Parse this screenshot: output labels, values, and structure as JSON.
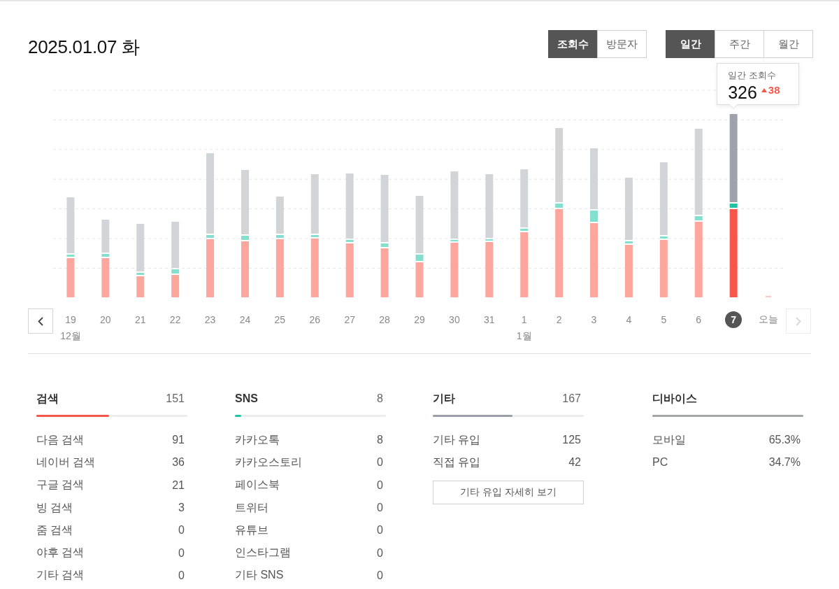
{
  "date_title": "2025.01.07 화",
  "metric_tabs": [
    {
      "label": "조회수",
      "selected": true
    },
    {
      "label": "방문자",
      "selected": false
    }
  ],
  "period_tabs": [
    {
      "label": "일간",
      "selected": true
    },
    {
      "label": "주간",
      "selected": false
    },
    {
      "label": "월간",
      "selected": false
    }
  ],
  "tooltip": {
    "title": "일간 조회수",
    "value": "326",
    "change": "38",
    "increase": true
  },
  "nav": {
    "prev_disabled": false,
    "next_disabled": true
  },
  "days": [
    {
      "day": "19",
      "month": "12월",
      "selected": false
    },
    {
      "day": "20",
      "selected": false
    },
    {
      "day": "21",
      "selected": false
    },
    {
      "day": "22",
      "selected": false
    },
    {
      "day": "23",
      "selected": false
    },
    {
      "day": "24",
      "selected": false
    },
    {
      "day": "25",
      "selected": false
    },
    {
      "day": "26",
      "selected": false
    },
    {
      "day": "27",
      "selected": false
    },
    {
      "day": "28",
      "selected": false
    },
    {
      "day": "29",
      "selected": false
    },
    {
      "day": "30",
      "selected": false
    },
    {
      "day": "31",
      "selected": false
    },
    {
      "day": "1",
      "month": "1월",
      "selected": false
    },
    {
      "day": "2",
      "selected": false
    },
    {
      "day": "3",
      "selected": false
    },
    {
      "day": "4",
      "selected": false
    },
    {
      "day": "5",
      "selected": false
    },
    {
      "day": "6",
      "selected": false
    },
    {
      "day": "7",
      "selected": true
    },
    {
      "day": "오늘",
      "selected": false
    }
  ],
  "sections": [
    {
      "title": "검색",
      "total": "151",
      "level": 0.48,
      "color": "#f2584a",
      "rows": [
        {
          "label": "다음 검색",
          "value": "91"
        },
        {
          "label": "네이버 검색",
          "value": "36"
        },
        {
          "label": "구글 검색",
          "value": "21"
        },
        {
          "label": "빙 검색",
          "value": "3"
        },
        {
          "label": "줌 검색",
          "value": "0"
        },
        {
          "label": "야후 검색",
          "value": "0"
        },
        {
          "label": "기타 검색",
          "value": "0"
        }
      ]
    },
    {
      "title": "SNS",
      "total": "8",
      "level": 0.04,
      "color": "#1fc3a4",
      "rows": [
        {
          "label": "카카오톡",
          "value": "8"
        },
        {
          "label": "카카오스토리",
          "value": "0"
        },
        {
          "label": "페이스북",
          "value": "0"
        },
        {
          "label": "트위터",
          "value": "0"
        },
        {
          "label": "유튜브",
          "value": "0"
        },
        {
          "label": "인스타그램",
          "value": "0"
        },
        {
          "label": "기타 SNS",
          "value": "0"
        }
      ]
    },
    {
      "title": "기타",
      "total": "167",
      "level": 0.53,
      "color": "#9a9ea8",
      "rows": [
        {
          "label": "기타 유입",
          "value": "125"
        },
        {
          "label": "직접 유입",
          "value": "42"
        }
      ],
      "button": "기타 유입 자세히 보기"
    },
    {
      "title": "디바이스",
      "level": 1,
      "color": "#a3a5a8",
      "rows": [
        {
          "label": "모바일",
          "value": "65.3%"
        },
        {
          "label": "PC",
          "value": "34.7%"
        }
      ]
    }
  ]
}
